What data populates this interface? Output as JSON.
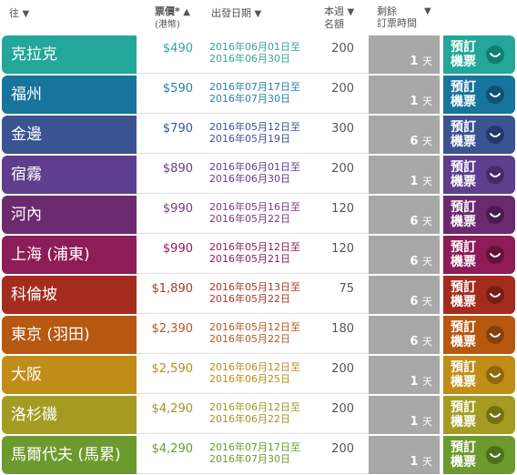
{
  "header": {
    "dest": "往",
    "price": "票價*",
    "price_sub": "(港幣)",
    "date": "出發日期",
    "quota_line1": "本週",
    "quota_line2": "名額",
    "remain_line1": "剩餘",
    "remain_line2": "訂票時間"
  },
  "rows": [
    {
      "dest": "克拉克",
      "price": "$490",
      "d1": "2016年06月01日至",
      "d2": "2016年06月30日",
      "quota": "200",
      "remain": "1",
      "unit": "天",
      "book": [
        "預訂",
        "機票"
      ],
      "color": "#22a79a",
      "dark": "#0f7d72",
      "text": "#3aa09c"
    },
    {
      "dest": "福州",
      "price": "$590",
      "d1": "2016年07月17日至",
      "d2": "2016年07月30日",
      "quota": "200",
      "remain": "1",
      "unit": "天",
      "book": [
        "預訂",
        "機票"
      ],
      "color": "#18749c",
      "dark": "#0d5274",
      "text": "#2a7fa8"
    },
    {
      "dest": "金邊",
      "price": "$790",
      "d1": "2016年05月12日至",
      "d2": "2016年05月19日",
      "quota": "300",
      "remain": "6",
      "unit": "天",
      "book": [
        "預訂",
        "機票"
      ],
      "color": "#3a5391",
      "dark": "#24386b",
      "text": "#3a5391"
    },
    {
      "dest": "宿霧",
      "price": "$890",
      "d1": "2016年06月01日至",
      "d2": "2016年06月30日",
      "quota": "200",
      "remain": "1",
      "unit": "天",
      "book": [
        "預訂",
        "機票"
      ],
      "color": "#5e3e8e",
      "dark": "#432a68",
      "text": "#5e3e8e"
    },
    {
      "dest": "河內",
      "price": "$990",
      "d1": "2016年05月16日至",
      "d2": "2016年05月22日",
      "quota": "120",
      "remain": "6",
      "unit": "天",
      "book": [
        "預訂",
        "機票"
      ],
      "color": "#6b2a6f",
      "dark": "#4a1b4d",
      "text": "#7a3a7e"
    },
    {
      "dest": "上海 (浦東)",
      "price": "$990",
      "d1": "2016年05月12日至",
      "d2": "2016年05月21日",
      "quota": "120",
      "remain": "6",
      "unit": "天",
      "book": [
        "預訂",
        "機票"
      ],
      "color": "#8d1c58",
      "dark": "#64113e",
      "text": "#8d1c58"
    },
    {
      "dest": "科倫坡",
      "price": "$1,890",
      "d1": "2016年05月13日至",
      "d2": "2016年05月22日",
      "quota": "75",
      "remain": "6",
      "unit": "天",
      "book": [
        "預訂",
        "機票"
      ],
      "color": "#a42c1e",
      "dark": "#771d12",
      "text": "#a43a2e"
    },
    {
      "dest": "東京 (羽田)",
      "price": "$2,390",
      "d1": "2016年05月12日至",
      "d2": "2016年05月22日",
      "quota": "180",
      "remain": "6",
      "unit": "天",
      "book": [
        "預訂",
        "機票"
      ],
      "color": "#b75811",
      "dark": "#85400a",
      "text": "#b05a1e"
    },
    {
      "dest": "大阪",
      "price": "$2,590",
      "d1": "2016年06月12日至",
      "d2": "2016年06月25日",
      "quota": "200",
      "remain": "1",
      "unit": "天",
      "book": [
        "預訂",
        "機票"
      ],
      "color": "#c18d18",
      "dark": "#8f670e",
      "text": "#b88d1e"
    },
    {
      "dest": "洛杉磯",
      "price": "$4,290",
      "d1": "2016年06月12日至",
      "d2": "2016年06月22日",
      "quota": "200",
      "remain": "1",
      "unit": "天",
      "book": [
        "預訂",
        "機票"
      ],
      "color": "#a49c22",
      "dark": "#767012",
      "text": "#9c962a"
    },
    {
      "dest": "馬爾代夫 (馬累)",
      "price": "$4,290",
      "d1": "2016年07月17日至",
      "d2": "2016年07月30日",
      "quota": "200",
      "remain": "1",
      "unit": "天",
      "book": [
        "預訂",
        "機票"
      ],
      "color": "#6d9a2e",
      "dark": "#4d701c",
      "text": "#6d9a2e"
    }
  ]
}
